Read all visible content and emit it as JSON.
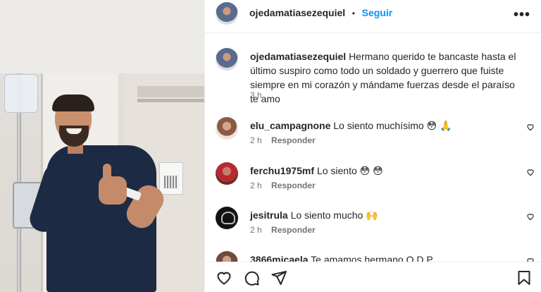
{
  "post": {
    "username": "ojedamatiasezequiel",
    "separator": "•",
    "follow_label": "Seguir",
    "more_label": "•••"
  },
  "caption": {
    "username": "ojedamatiasezequiel",
    "text": "Hermano querido te bancaste hasta el último suspiro como todo un soldado y guerrero que fuiste siempre en mi corazón y mándame fuerzas desde el paraíso te amo",
    "time": "3 h"
  },
  "comments": [
    {
      "username": "elu_campagnone",
      "text": "Lo siento muchísimo 😳 🙏",
      "time": "2 h",
      "reply_label": "Responder"
    },
    {
      "username": "ferchu1975mf",
      "text": "Lo siento 😳 😳",
      "time": "2 h",
      "reply_label": "Responder"
    },
    {
      "username": "jesitrula",
      "text": "Lo siento mucho 🙌",
      "time": "2 h",
      "reply_label": "Responder"
    },
    {
      "username": "3866micaela",
      "text": "Te amamos hermano Q.D.P"
    }
  ],
  "colors": {
    "link": "#0095f6",
    "text": "#262626",
    "muted": "#737373",
    "border": "#efefef"
  },
  "icons": {
    "heart": "heart-icon",
    "comment": "comment-icon",
    "share": "share-icon",
    "save": "bookmark-icon",
    "more": "more-icon"
  }
}
